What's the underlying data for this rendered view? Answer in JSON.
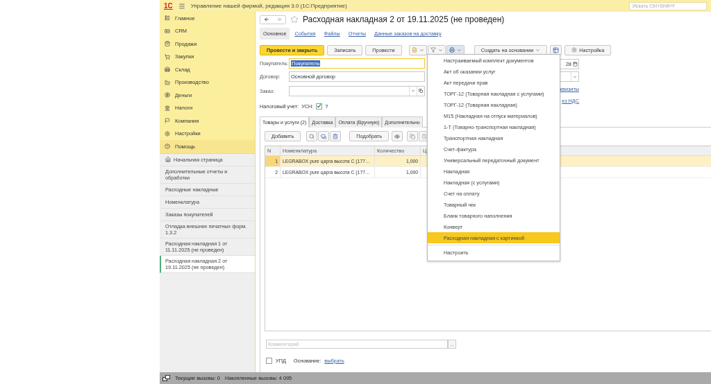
{
  "header": {
    "logo": "1С",
    "title": "Управление нашей фирмой, редакция 3.0  (1С:Предприятие)",
    "search_placeholder": "Искать Ctrl+Shift+F"
  },
  "sections": [
    {
      "label": "Главное",
      "selected": false
    },
    {
      "label": "CRM",
      "selected": false
    },
    {
      "label": "Продажи",
      "selected": false
    },
    {
      "label": "Закупки",
      "selected": false
    },
    {
      "label": "Склад",
      "selected": false
    },
    {
      "label": "Производство",
      "selected": false
    },
    {
      "label": "Деньги",
      "selected": false
    },
    {
      "label": "Налоги",
      "selected": false
    },
    {
      "label": "Компания",
      "selected": false
    },
    {
      "label": "Настройки",
      "selected": false
    },
    {
      "label": "Помощь",
      "selected": true
    }
  ],
  "open_windows": [
    {
      "label": "Начальная страница",
      "selected": false
    },
    {
      "label": "Дополнительные отчеты и обработки",
      "selected": false
    },
    {
      "label": "Расходные накладные",
      "selected": false
    },
    {
      "label": "Номенклатура",
      "selected": false
    },
    {
      "label": "Заказы покупателей",
      "selected": false
    },
    {
      "label": "Отладка внешних печатных форм. 1.3.2",
      "selected": false
    },
    {
      "label": "Расходная накладная 1 от 11.11.2025 (не проведен)",
      "selected": false
    },
    {
      "label": "Расходная накладная 2 от 19.11.2025 (не проведен)",
      "selected": true
    }
  ],
  "document": {
    "title": "Расходная накладная 2 от 19.11.2025 (не проведен)",
    "tabs": [
      {
        "label": "Основное",
        "selected": true
      },
      {
        "label": "События",
        "selected": false
      },
      {
        "label": "Файлы",
        "selected": false
      },
      {
        "label": "Отчеты",
        "selected": false
      },
      {
        "label": "Данные заказов на доставку",
        "selected": false
      }
    ],
    "toolbar": {
      "post_close": "Провести и закрыть",
      "save": "Записать",
      "post": "Провести",
      "create_based": "Создать на основании",
      "settings": "Настройка"
    },
    "buyer": {
      "label": "Покупатель:",
      "value": "Покупатель"
    },
    "contract": {
      "label": "Договор:",
      "value": "Основной договор"
    },
    "order": {
      "label": "Заказ:"
    },
    "tax": {
      "label": "Налоговый учет:",
      "usn_label": "УСН:",
      "usn_checked": true,
      "help": "?"
    },
    "date_tail": "28",
    "link_tail_1": "квизиты",
    "link_tail_2": "ез НДС",
    "inner_tabs": [
      {
        "label": "Товары и услуги (2)",
        "selected": true
      },
      {
        "label": "Доставка",
        "selected": false
      },
      {
        "label": "Оплата (Вручную)",
        "selected": false
      },
      {
        "label": "Дополнительно",
        "selected": false
      }
    ],
    "table_toolbar": {
      "add": "Добавить",
      "pick": "Подобрать"
    },
    "table": {
      "columns": [
        "N",
        "Номенклатура",
        "Количество",
        "Ц"
      ],
      "rows": [
        {
          "n": "1",
          "item": "LEGRABOX pure царга высота C (177…",
          "qty": "1,000",
          "selected": true
        },
        {
          "n": "2",
          "item": "LEGRABOX pure царга высота C (177…",
          "qty": "1,000",
          "selected": false
        }
      ]
    },
    "comment": {
      "placeholder": "Комментарий",
      "button": "..."
    },
    "upd": {
      "label": "УПД",
      "checked": false
    },
    "basis": {
      "label": "Основание:",
      "link": "выбрать"
    }
  },
  "print_menu": {
    "items": [
      {
        "label": "Настраиваемый комплект документов",
        "selected": false
      },
      {
        "label": "Акт об оказании услуг",
        "selected": false
      },
      {
        "label": "Акт передачи прав",
        "selected": false
      },
      {
        "label": "ТОРГ-12 (Товарная накладная с услугами)",
        "selected": false
      },
      {
        "label": "ТОРГ-12 (Товарная накладная)",
        "selected": false
      },
      {
        "label": "М15 (Накладная на отпуск материалов)",
        "selected": false
      },
      {
        "label": "1-Т (Товарно-транспортная накладная)",
        "selected": false
      },
      {
        "label": "Транспортная накладная",
        "selected": false
      },
      {
        "label": "Счет-фактура",
        "selected": false
      },
      {
        "label": "Универсальный передаточный документ",
        "selected": false
      },
      {
        "label": "Накладная",
        "selected": false
      },
      {
        "label": "Накладная (с услугами)",
        "selected": false
      },
      {
        "label": "Счет на оплату",
        "selected": false
      },
      {
        "label": "Товарный чек",
        "selected": false
      },
      {
        "label": "Бланк товарного наполнения",
        "selected": false
      },
      {
        "label": "Конверт",
        "selected": false
      },
      {
        "label": "Расходная накладная с картинкой",
        "selected": true
      }
    ],
    "footer": "Настроить"
  },
  "status_bar": {
    "current_calls": "Текущие вызовы: 0",
    "total_calls": "Накопленные вызовы: 4 095"
  }
}
